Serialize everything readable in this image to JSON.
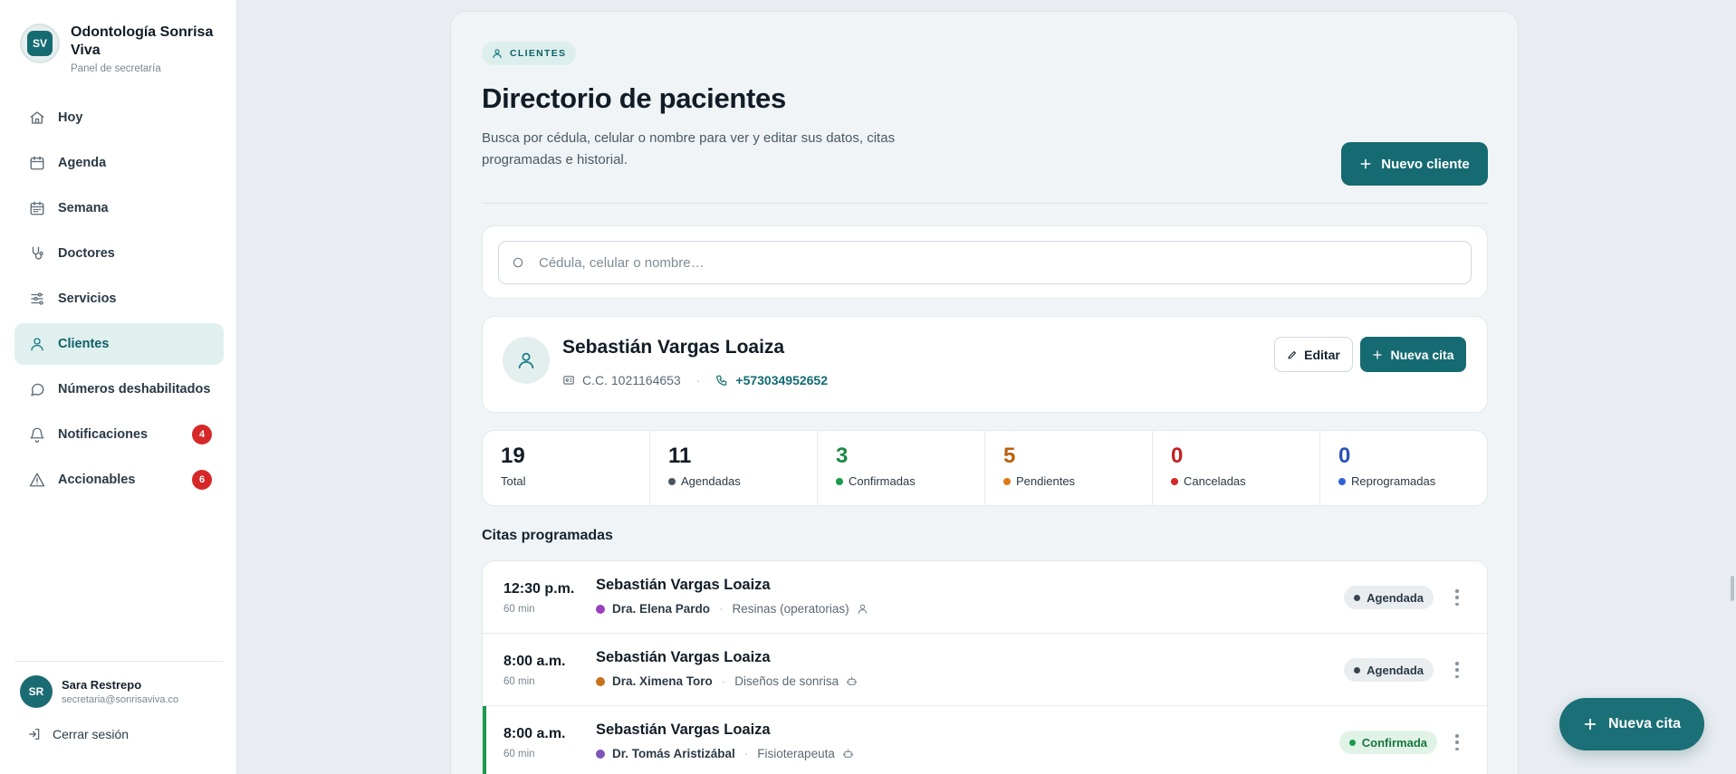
{
  "brand": {
    "initials": "SV",
    "name": "Odontología Sonrisa Viva",
    "subtitle": "Panel de secretaría"
  },
  "sidebar": {
    "items": [
      {
        "label": "Hoy",
        "icon": "home-icon"
      },
      {
        "label": "Agenda",
        "icon": "calendar-icon"
      },
      {
        "label": "Semana",
        "icon": "calendar-week-icon"
      },
      {
        "label": "Doctores",
        "icon": "stethoscope-icon"
      },
      {
        "label": "Servicios",
        "icon": "sliders-icon"
      },
      {
        "label": "Clientes",
        "icon": "user-icon",
        "active": true
      },
      {
        "label": "Números deshabilitados",
        "icon": "message-icon"
      },
      {
        "label": "Notificaciones",
        "icon": "bell-icon",
        "badge": "4"
      },
      {
        "label": "Accionables",
        "icon": "warning-icon",
        "badge": "6"
      }
    ]
  },
  "user": {
    "initials": "SR",
    "name": "Sara Restrepo",
    "email": "secretaria@sonrisaviva.co",
    "logout_label": "Cerrar sesión"
  },
  "header": {
    "chip_label": "CLIENTES",
    "title": "Directorio de pacientes",
    "description": "Busca por cédula, celular o nombre para ver y editar sus datos, citas programadas e historial.",
    "new_client_label": "Nuevo cliente"
  },
  "search": {
    "placeholder": "Cédula, celular o nombre…",
    "value": ""
  },
  "patient": {
    "name": "Sebastián Vargas Loaiza",
    "id_label": "C.C. 1021164653",
    "phone": "+573034952652",
    "edit_label": "Editar",
    "new_appt_label": "Nueva cita"
  },
  "stats": [
    {
      "value": "19",
      "label": "Total",
      "color": "#111c26",
      "dot": null
    },
    {
      "value": "11",
      "label": "Agendadas",
      "color": "#111c26",
      "dot": "#4a5560"
    },
    {
      "value": "3",
      "label": "Confirmadas",
      "color": "#1a8a45",
      "dot": "#1a9a4c"
    },
    {
      "value": "5",
      "label": "Pendientes",
      "color": "#b8600e",
      "dot": "#dd7a16"
    },
    {
      "value": "0",
      "label": "Canceladas",
      "color": "#c42020",
      "dot": "#d62828"
    },
    {
      "value": "0",
      "label": "Reprogramadas",
      "color": "#2a52b8",
      "dot": "#2f62d8"
    }
  ],
  "appointments_title": "Citas programadas",
  "appointments": [
    {
      "time": "12:30 p.m.",
      "duration": "60 min",
      "patient": "Sebastián Vargas Loaiza",
      "doctor": "Dra. Elena Pardo",
      "doctor_color": "#9b3fbf",
      "service": "Resinas (operatorias)",
      "channel_icon": "person-icon",
      "status": "Agendada"
    },
    {
      "time": "8:00 a.m.",
      "duration": "60 min",
      "patient": "Sebastián Vargas Loaiza",
      "doctor": "Dra. Ximena Toro",
      "doctor_color": "#c8721c",
      "service": "Diseños de sonrisa",
      "channel_icon": "robot-icon",
      "status": "Agendada"
    },
    {
      "time": "8:00 a.m.",
      "duration": "60 min",
      "patient": "Sebastián Vargas Loaiza",
      "doctor": "Dr. Tomás Aristizábal",
      "doctor_color": "#7b55b8",
      "service": "Fisioterapeuta",
      "channel_icon": "robot-icon",
      "status": "Confirmada"
    }
  ],
  "fab_label": "Nueva cita"
}
